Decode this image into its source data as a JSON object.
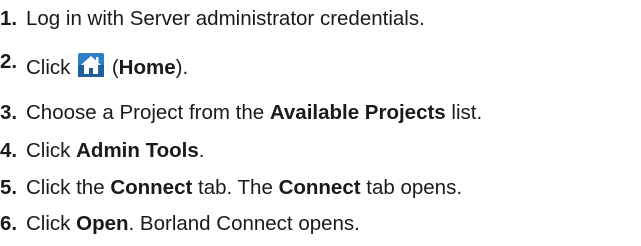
{
  "steps": [
    {
      "number": "1.",
      "text": "Log in with Server administrator credentials."
    },
    {
      "number": "2.",
      "prefix": "Click",
      "icon": "home-icon",
      "bold": "Home",
      "paren_open": "(",
      "paren_close": ")."
    },
    {
      "number": "3.",
      "prefix": "Choose a Project from the",
      "bold": "Available Projects",
      "suffix": "list."
    },
    {
      "number": "4.",
      "prefix": "Click",
      "bold": "Admin Tools",
      "suffix": "."
    },
    {
      "number": "5.",
      "prefix": "Click the",
      "bold": "Connect",
      "middle": "tab. The",
      "bold2": "Connect",
      "suffix": "tab opens."
    },
    {
      "number": "6.",
      "prefix": "Click",
      "bold": "Open",
      "suffix": ". Borland Connect opens."
    }
  ],
  "colors": {
    "text": "#1a1a1a",
    "icon_blue": "#2f7fc4",
    "icon_blue_dark": "#1f5f9a",
    "icon_roof": "#ffffff"
  }
}
